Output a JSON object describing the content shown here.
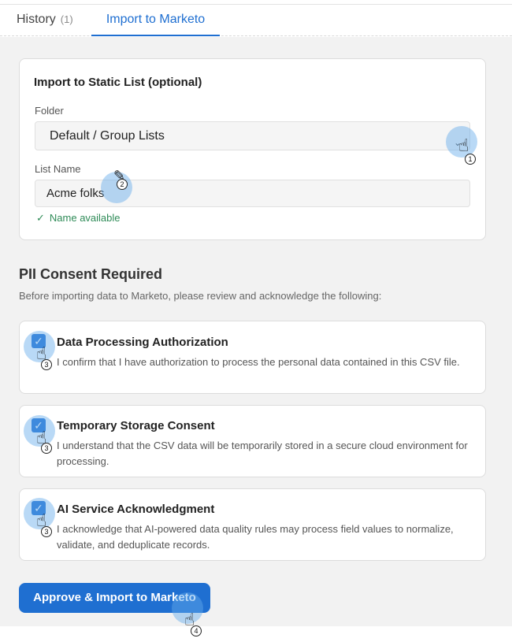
{
  "tabs": {
    "history_label": "History",
    "history_count": "(1)",
    "import_label": "Import to Marketo"
  },
  "static_list": {
    "title": "Import to Static List (optional)",
    "folder_label": "Folder",
    "folder_value": "Default / Group Lists",
    "list_name_label": "List Name",
    "list_name_value": "Acme folks",
    "status": "Name available"
  },
  "pii": {
    "title": "PII Consent Required",
    "subtitle": "Before importing data to Marketo, please review and acknowledge the following:",
    "items": [
      {
        "title": "Data Processing Authorization",
        "desc": "I confirm that I have authorization to process the personal data contained in this CSV file.",
        "checked": true
      },
      {
        "title": "Temporary Storage Consent",
        "desc": "I understand that the CSV data will be temporarily stored in a secure cloud environment for processing.",
        "checked": true
      },
      {
        "title": "AI Service Acknowledgment",
        "desc": "I acknowledge that AI-powered data quality rules may process field values to normalize, validate, and deduplicate records.",
        "checked": true
      }
    ]
  },
  "action": {
    "button_label": "Approve & Import to Marketo"
  },
  "annotations": {
    "step1": "1",
    "step2": "2",
    "step3a": "3",
    "step3b": "3",
    "step3c": "3",
    "step4": "4"
  },
  "colors": {
    "accent": "#1f6fd1",
    "success": "#2e8b57",
    "highlight": "#64aaeb"
  },
  "icons": {
    "dropdown": "chevron-down-icon",
    "check": "checkmark-icon",
    "pointer": "hand-pointer-icon",
    "edit": "pencil-icon"
  }
}
